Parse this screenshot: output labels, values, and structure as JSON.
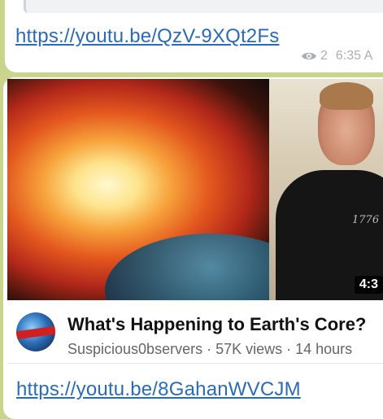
{
  "message_1": {
    "link": "https://youtu.be/QzV-9XQt2Fs",
    "views": "2",
    "time": "6:35 A"
  },
  "message_2": {
    "video": {
      "duration": "4:3",
      "shirt_text": "1776",
      "title": "What's Happening to Earth's Core?",
      "subtitle": "Suspicious0bservers · 57K views · 14 hours",
      "sub_cut": "· · ·"
    },
    "link": "https://youtu.be/8GahanWVCJM"
  },
  "icons": {
    "views": "eye-icon",
    "channel": "channel-avatar"
  },
  "colors": {
    "chat_background": "#c9d48d",
    "bubble": "#ffffff",
    "link": "#2d6bb0",
    "meta": "#a9aeb3"
  }
}
